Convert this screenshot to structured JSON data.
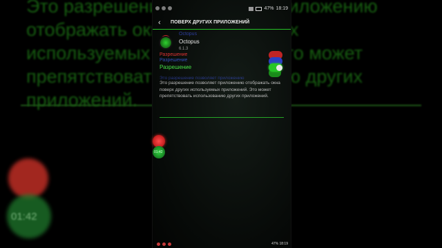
{
  "background": {
    "text": "Это разрешение позволяет приложению отображать окна поверх других используемых приложений. Это может препятствовать использованию других приложений.",
    "bubble_label": "01:42"
  },
  "statusbar": {
    "battery": "47%",
    "time": "18:19"
  },
  "toolbar": {
    "title": "ПОВЕРХ ДРУГИХ ПРИЛОЖЕНИЙ",
    "back_icon": "chevron-left-icon"
  },
  "app": {
    "ghost_name": "Octopus",
    "name": "Octopus",
    "version": "6.1.3",
    "icon": "octopus-app-icon"
  },
  "permission": {
    "ghost_label_red": "Разрешение",
    "ghost_label_blue": "Разрешение",
    "label": "Разрешение",
    "toggle_on": true
  },
  "description": {
    "ghost": "Это разрешение позволяет приложению",
    "text": "Это разрешение позволяет приложению отображать окна поверх других используемых приложений. Это может препятствовать использованию других приложений."
  },
  "floating_bubble": {
    "label": "01:42"
  },
  "navbar": {
    "battery": "47%",
    "time": "18:19"
  },
  "colors": {
    "accent": "#27c627",
    "danger": "#c02424",
    "blue": "#2a3fc4"
  }
}
